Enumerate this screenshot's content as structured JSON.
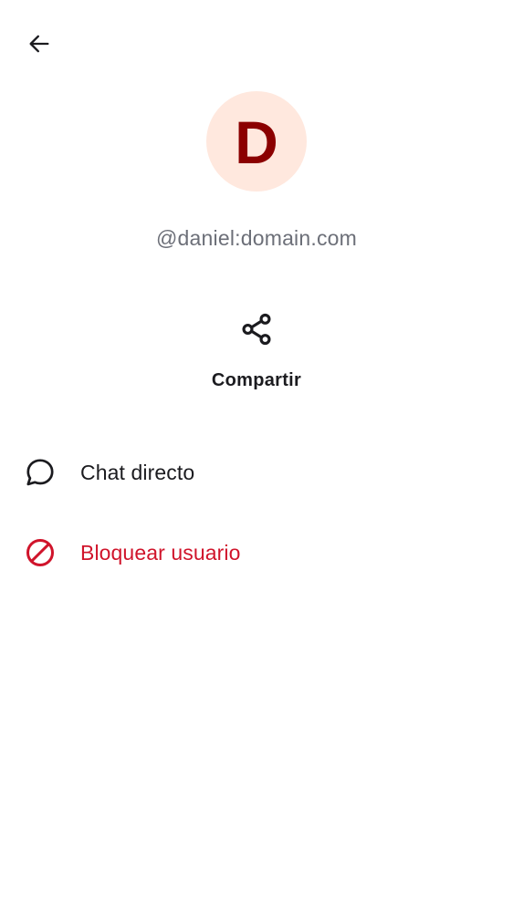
{
  "header": {
    "back_icon": "arrow-left-icon"
  },
  "profile": {
    "avatar_letter": "D",
    "avatar_bg": "#ffe8de",
    "avatar_fg": "#8b0000",
    "user_id": "@daniel:domain.com"
  },
  "actions": {
    "share": {
      "label": "Compartir",
      "icon": "share-icon"
    }
  },
  "menu": {
    "items": [
      {
        "label": "Chat directo",
        "icon": "chat-bubble-icon",
        "color": "#1b1b1f"
      },
      {
        "label": "Bloquear usuario",
        "icon": "block-icon",
        "color": "#d0142b"
      }
    ]
  }
}
